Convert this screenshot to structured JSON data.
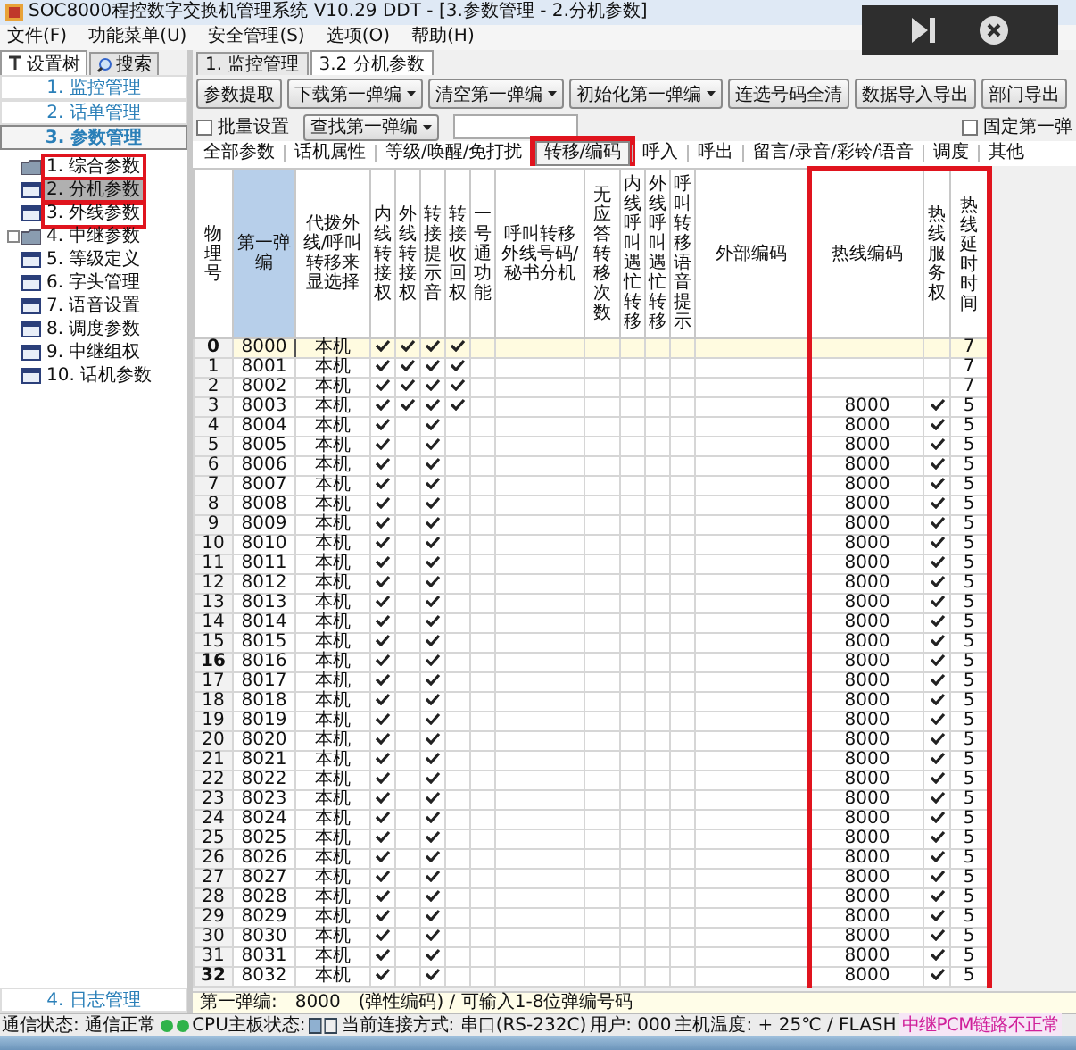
{
  "window": {
    "title": "SOC8000程控数字交换机管理系统 V10.29 DDT - [3.参数管理 - 2.分机参数]"
  },
  "menu": [
    "文件(F)",
    "功能菜单(U)",
    "安全管理(S)",
    "选项(O)",
    "帮助(H)"
  ],
  "sidebar": {
    "tabs": [
      {
        "label": "设置树",
        "selected": true
      },
      {
        "label": "搜索",
        "selected": false
      }
    ],
    "groups": [
      {
        "label": "1. 监控管理",
        "selected": false
      },
      {
        "label": "2. 话单管理",
        "selected": false
      },
      {
        "label": "3. 参数管理",
        "selected": true
      }
    ],
    "tree": [
      {
        "label": "1. 综合参数",
        "kind": "folder",
        "selected": false,
        "highlighted": true,
        "expandable": false
      },
      {
        "label": "2. 分机参数",
        "kind": "table",
        "selected": true,
        "highlighted": true,
        "expandable": false
      },
      {
        "label": "3. 外线参数",
        "kind": "table",
        "selected": false,
        "highlighted": true,
        "expandable": false
      },
      {
        "label": "4. 中继参数",
        "kind": "folder",
        "selected": false,
        "highlighted": false,
        "expandable": true
      },
      {
        "label": "5. 等级定义",
        "kind": "table",
        "selected": false,
        "highlighted": false,
        "expandable": false
      },
      {
        "label": "6. 字头管理",
        "kind": "table",
        "selected": false,
        "highlighted": false,
        "expandable": false
      },
      {
        "label": "7. 语音设置",
        "kind": "table",
        "selected": false,
        "highlighted": false,
        "expandable": false
      },
      {
        "label": "8. 调度参数",
        "kind": "table",
        "selected": false,
        "highlighted": false,
        "expandable": false
      },
      {
        "label": "9. 中继组权",
        "kind": "table",
        "selected": false,
        "highlighted": false,
        "expandable": false
      },
      {
        "label": "10. 话机参数",
        "kind": "table",
        "selected": false,
        "highlighted": false,
        "expandable": false
      }
    ],
    "bottom_group": {
      "label": "4. 日志管理",
      "selected": false
    }
  },
  "doc_tabs": [
    {
      "label": "1. 监控管理",
      "selected": false
    },
    {
      "label": "3.2 分机参数",
      "selected": true
    }
  ],
  "toolbar": [
    {
      "label": "参数提取",
      "dropdown": false
    },
    {
      "label": "下载第一弹编",
      "dropdown": true
    },
    {
      "label": "清空第一弹编",
      "dropdown": true
    },
    {
      "label": "初始化第一弹编",
      "dropdown": true
    },
    {
      "label": "连选号码全清",
      "dropdown": false
    },
    {
      "label": "数据导入导出",
      "dropdown": false
    },
    {
      "label": "部门导出",
      "dropdown": false
    }
  ],
  "toolbar2": {
    "batch": {
      "label": "批量设置",
      "checked": false
    },
    "find": {
      "label": "查找第一弹编",
      "dropdown": true
    },
    "fixed": {
      "label": "固定第一弹",
      "checked": false
    }
  },
  "filter_tabs": [
    {
      "label": "全部参数",
      "selected": false,
      "highlighted": false
    },
    {
      "label": "话机属性",
      "selected": false,
      "highlighted": false
    },
    {
      "label": "等级/唤醒/免打扰",
      "selected": false,
      "highlighted": false
    },
    {
      "label": "转移/编码",
      "selected": true,
      "highlighted": true
    },
    {
      "label": "呼入",
      "selected": false,
      "highlighted": false
    },
    {
      "label": "呼出",
      "selected": false,
      "highlighted": false
    },
    {
      "label": "留言/录音/彩铃/语音",
      "selected": false,
      "highlighted": false
    },
    {
      "label": "调度",
      "selected": false,
      "highlighted": false
    },
    {
      "label": "其他",
      "selected": false,
      "highlighted": false
    }
  ],
  "table": {
    "columns": [
      {
        "label": "物理号",
        "kind": "vertical",
        "selected": false,
        "highlighted": false
      },
      {
        "label": "第一弹编",
        "kind": "horizontal",
        "selected": true,
        "highlighted": false
      },
      {
        "label": "代拨外线/呼叫转移来显选择",
        "kind": "horizontal",
        "selected": false,
        "highlighted": false
      },
      {
        "label": "内线转接权",
        "kind": "vertical",
        "selected": false,
        "highlighted": false
      },
      {
        "label": "外线转接权",
        "kind": "vertical",
        "selected": false,
        "highlighted": false
      },
      {
        "label": "转接提示音",
        "kind": "vertical",
        "selected": false,
        "highlighted": false
      },
      {
        "label": "转接收回权",
        "kind": "vertical",
        "selected": false,
        "highlighted": false
      },
      {
        "label": "一号通功能",
        "kind": "vertical",
        "selected": false,
        "highlighted": false
      },
      {
        "label": "呼叫转移外线号码/秘书分机",
        "kind": "horizontal",
        "selected": false,
        "highlighted": false
      },
      {
        "label": "无应答转移次数",
        "kind": "vertical",
        "selected": false,
        "highlighted": false
      },
      {
        "label": "内线呼叫遇忙转移",
        "kind": "vertical",
        "selected": false,
        "highlighted": false
      },
      {
        "label": "外线呼叫遇忙转移",
        "kind": "vertical",
        "selected": false,
        "highlighted": false
      },
      {
        "label": "呼叫转移语音提示",
        "kind": "vertical",
        "selected": false,
        "highlighted": false
      },
      {
        "label": "外部编码",
        "kind": "horizontal",
        "selected": false,
        "highlighted": false
      },
      {
        "label": "热线编码",
        "kind": "horizontal",
        "selected": false,
        "highlighted": true
      },
      {
        "label": "热线服务权",
        "kind": "vertical",
        "selected": false,
        "highlighted": true
      },
      {
        "label": "热线延时时间",
        "kind": "horizontal",
        "selected": false,
        "highlighted": true
      }
    ],
    "rows": [
      {
        "no": "0",
        "bold": true,
        "selected": true,
        "number": "8000",
        "display": "本机",
        "checks": [
          true,
          true,
          true,
          true
        ],
        "hotline_service": false,
        "delay": "7"
      },
      {
        "no": "1",
        "bold": false,
        "selected": false,
        "number": "8001",
        "display": "本机",
        "checks": [
          true,
          true,
          true,
          true
        ],
        "hotline_service": false,
        "delay": "7"
      },
      {
        "no": "2",
        "bold": false,
        "selected": false,
        "number": "8002",
        "display": "本机",
        "checks": [
          true,
          true,
          true,
          true
        ],
        "hotline_service": false,
        "delay": "7"
      },
      {
        "no": "3",
        "bold": false,
        "selected": false,
        "number": "8003",
        "display": "本机",
        "checks": [
          true,
          true,
          true,
          true
        ],
        "hotline": "8000",
        "hotline_service": true,
        "delay": "5"
      },
      {
        "no": "4",
        "bold": false,
        "selected": false,
        "number": "8004",
        "display": "本机",
        "checks": [
          true,
          false,
          true,
          false
        ],
        "hotline": "8000",
        "hotline_service": true,
        "delay": "5"
      },
      {
        "no": "5",
        "bold": false,
        "selected": false,
        "number": "8005",
        "display": "本机",
        "checks": [
          true,
          false,
          true,
          false
        ],
        "hotline": "8000",
        "hotline_service": true,
        "delay": "5"
      },
      {
        "no": "6",
        "bold": false,
        "selected": false,
        "number": "8006",
        "display": "本机",
        "checks": [
          true,
          false,
          true,
          false
        ],
        "hotline": "8000",
        "hotline_service": true,
        "delay": "5"
      },
      {
        "no": "7",
        "bold": false,
        "selected": false,
        "number": "8007",
        "display": "本机",
        "checks": [
          true,
          false,
          true,
          false
        ],
        "hotline": "8000",
        "hotline_service": true,
        "delay": "5"
      },
      {
        "no": "8",
        "bold": false,
        "selected": false,
        "number": "8008",
        "display": "本机",
        "checks": [
          true,
          false,
          true,
          false
        ],
        "hotline": "8000",
        "hotline_service": true,
        "delay": "5"
      },
      {
        "no": "9",
        "bold": false,
        "selected": false,
        "number": "8009",
        "display": "本机",
        "checks": [
          true,
          false,
          true,
          false
        ],
        "hotline": "8000",
        "hotline_service": true,
        "delay": "5"
      },
      {
        "no": "10",
        "bold": false,
        "selected": false,
        "number": "8010",
        "display": "本机",
        "checks": [
          true,
          false,
          true,
          false
        ],
        "hotline": "8000",
        "hotline_service": true,
        "delay": "5"
      },
      {
        "no": "11",
        "bold": false,
        "selected": false,
        "number": "8011",
        "display": "本机",
        "checks": [
          true,
          false,
          true,
          false
        ],
        "hotline": "8000",
        "hotline_service": true,
        "delay": "5"
      },
      {
        "no": "12",
        "bold": false,
        "selected": false,
        "number": "8012",
        "display": "本机",
        "checks": [
          true,
          false,
          true,
          false
        ],
        "hotline": "8000",
        "hotline_service": true,
        "delay": "5"
      },
      {
        "no": "13",
        "bold": false,
        "selected": false,
        "number": "8013",
        "display": "本机",
        "checks": [
          true,
          false,
          true,
          false
        ],
        "hotline": "8000",
        "hotline_service": true,
        "delay": "5"
      },
      {
        "no": "14",
        "bold": false,
        "selected": false,
        "number": "8014",
        "display": "本机",
        "checks": [
          true,
          false,
          true,
          false
        ],
        "hotline": "8000",
        "hotline_service": true,
        "delay": "5"
      },
      {
        "no": "15",
        "bold": false,
        "selected": false,
        "number": "8015",
        "display": "本机",
        "checks": [
          true,
          false,
          true,
          false
        ],
        "hotline": "8000",
        "hotline_service": true,
        "delay": "5"
      },
      {
        "no": "16",
        "bold": true,
        "selected": false,
        "number": "8016",
        "display": "本机",
        "checks": [
          true,
          false,
          true,
          false
        ],
        "hotline": "8000",
        "hotline_service": true,
        "delay": "5"
      },
      {
        "no": "17",
        "bold": false,
        "selected": false,
        "number": "8017",
        "display": "本机",
        "checks": [
          true,
          false,
          true,
          false
        ],
        "hotline": "8000",
        "hotline_service": true,
        "delay": "5"
      },
      {
        "no": "18",
        "bold": false,
        "selected": false,
        "number": "8018",
        "display": "本机",
        "checks": [
          true,
          false,
          true,
          false
        ],
        "hotline": "8000",
        "hotline_service": true,
        "delay": "5"
      },
      {
        "no": "19",
        "bold": false,
        "selected": false,
        "number": "8019",
        "display": "本机",
        "checks": [
          true,
          false,
          true,
          false
        ],
        "hotline": "8000",
        "hotline_service": true,
        "delay": "5"
      },
      {
        "no": "20",
        "bold": false,
        "selected": false,
        "number": "8020",
        "display": "本机",
        "checks": [
          true,
          false,
          true,
          false
        ],
        "hotline": "8000",
        "hotline_service": true,
        "delay": "5"
      },
      {
        "no": "21",
        "bold": false,
        "selected": false,
        "number": "8021",
        "display": "本机",
        "checks": [
          true,
          false,
          true,
          false
        ],
        "hotline": "8000",
        "hotline_service": true,
        "delay": "5"
      },
      {
        "no": "22",
        "bold": false,
        "selected": false,
        "number": "8022",
        "display": "本机",
        "checks": [
          true,
          false,
          true,
          false
        ],
        "hotline": "8000",
        "hotline_service": true,
        "delay": "5"
      },
      {
        "no": "23",
        "bold": false,
        "selected": false,
        "number": "8023",
        "display": "本机",
        "checks": [
          true,
          false,
          true,
          false
        ],
        "hotline": "8000",
        "hotline_service": true,
        "delay": "5"
      },
      {
        "no": "24",
        "bold": false,
        "selected": false,
        "number": "8024",
        "display": "本机",
        "checks": [
          true,
          false,
          true,
          false
        ],
        "hotline": "8000",
        "hotline_service": true,
        "delay": "5"
      },
      {
        "no": "25",
        "bold": false,
        "selected": false,
        "number": "8025",
        "display": "本机",
        "checks": [
          true,
          false,
          true,
          false
        ],
        "hotline": "8000",
        "hotline_service": true,
        "delay": "5"
      },
      {
        "no": "26",
        "bold": false,
        "selected": false,
        "number": "8026",
        "display": "本机",
        "checks": [
          true,
          false,
          true,
          false
        ],
        "hotline": "8000",
        "hotline_service": true,
        "delay": "5"
      },
      {
        "no": "27",
        "bold": false,
        "selected": false,
        "number": "8027",
        "display": "本机",
        "checks": [
          true,
          false,
          true,
          false
        ],
        "hotline": "8000",
        "hotline_service": true,
        "delay": "5"
      },
      {
        "no": "28",
        "bold": false,
        "selected": false,
        "number": "8028",
        "display": "本机",
        "checks": [
          true,
          false,
          true,
          false
        ],
        "hotline": "8000",
        "hotline_service": true,
        "delay": "5"
      },
      {
        "no": "29",
        "bold": false,
        "selected": false,
        "number": "8029",
        "display": "本机",
        "checks": [
          true,
          false,
          true,
          false
        ],
        "hotline": "8000",
        "hotline_service": true,
        "delay": "5"
      },
      {
        "no": "30",
        "bold": false,
        "selected": false,
        "number": "8030",
        "display": "本机",
        "checks": [
          true,
          false,
          true,
          false
        ],
        "hotline": "8000",
        "hotline_service": true,
        "delay": "5"
      },
      {
        "no": "31",
        "bold": false,
        "selected": false,
        "number": "8031",
        "display": "本机",
        "checks": [
          true,
          false,
          true,
          false
        ],
        "hotline": "8000",
        "hotline_service": true,
        "delay": "5"
      },
      {
        "no": "32",
        "bold": true,
        "selected": false,
        "number": "8032",
        "display": "本机",
        "checks": [
          true,
          false,
          true,
          false
        ],
        "hotline": "8000",
        "hotline_service": true,
        "delay": "5"
      }
    ]
  },
  "hint": {
    "label": "第一弹编:",
    "value": "8000",
    "text": "(弹性编码) / 可输入1-8位弹编号码"
  },
  "status_bar": {
    "comm_label": "通信状态: 通信正常",
    "comm_ok": true,
    "cpu_label": "CPU主板状态:",
    "connection": "当前连接方式: 串口(RS-232C)",
    "user": "用户: 000",
    "temperature": "主机温度: + 25℃ / FLASH",
    "alarm": "中继PCM链路不正常"
  }
}
